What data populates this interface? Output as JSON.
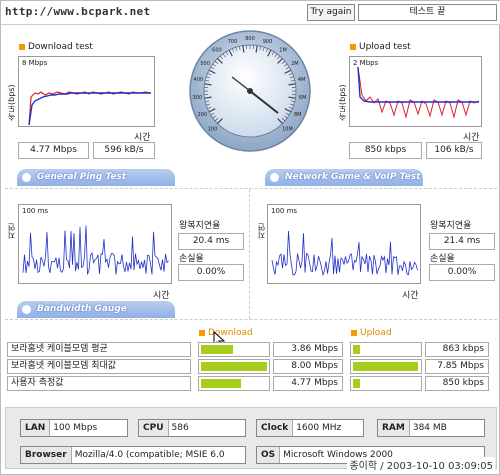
{
  "url": "http://www.bcpark.net",
  "buttons": {
    "try_again": "Try again",
    "end_test": "테스트 끝"
  },
  "download": {
    "title": "Download test",
    "scale": "8 Mbps",
    "ylabel": "속도(bps)",
    "xlabel": "시간",
    "kbps": "4.77 Mbps",
    "kBs": "596 kB/s"
  },
  "upload": {
    "title": "Upload test",
    "scale": "2 Mbps",
    "ylabel": "속도(bps)",
    "xlabel": "시간",
    "kbps": "850 kbps",
    "kBs": "106 kB/s"
  },
  "gauge_labels": [
    "100",
    "200",
    "300",
    "400",
    "500",
    "600",
    "700",
    "800",
    "900",
    "1M",
    "2M",
    "4M",
    "6M",
    "8M",
    "10M"
  ],
  "banners": {
    "ping": "General Ping Test",
    "game": "Network Game & VoIP Test",
    "bandwidth": "Bandwidth Gauge"
  },
  "ping_left": {
    "scale": "100 ms",
    "ylabel": "지연(ms)",
    "xlabel": "시간",
    "rtt_label": "왕복지연율",
    "rtt": "20.4 ms",
    "loss_label": "손실율",
    "loss": "0.00%"
  },
  "ping_right": {
    "scale": "100 ms",
    "ylabel": "지연(ms)",
    "xlabel": "시간",
    "rtt_label": "왕복지연율",
    "rtt": "21.4 ms",
    "loss_label": "손실율",
    "loss": "0.00%"
  },
  "gauge_headers": {
    "download": "Download",
    "upload": "Upload"
  },
  "rows": [
    {
      "label": "보라홈넷 케이블모뎀 평균",
      "down": "3.86 Mbps",
      "down_pct": 0.48,
      "up": "863 kbps",
      "up_pct": 0.11
    },
    {
      "label": "보라홈넷 케이블모뎀 최대값",
      "down": "8.00 Mbps",
      "down_pct": 1.0,
      "up": "7.85 Mbps",
      "up_pct": 0.98
    },
    {
      "label": "사용자 측정값",
      "down": "4.77 Mbps",
      "down_pct": 0.6,
      "up": "850 kbps",
      "up_pct": 0.11
    }
  ],
  "info": {
    "lan_k": "LAN",
    "lan_v": "100 Mbps",
    "cpu_k": "CPU",
    "cpu_v": "586",
    "clock_k": "Clock",
    "clock_v": "1600 MHz",
    "ram_k": "RAM",
    "ram_v": "384 MB",
    "browser_k": "Browser",
    "browser_v": "Mozilla/4.0 (compatible; MSIE 6.0",
    "os_k": "OS",
    "os_v": "Microsoft Windows 2000"
  },
  "footer": "종이학 / 2003-10-10 03:09:05",
  "colors": {
    "accent": "#f59a00",
    "bar": "#a6cc1c",
    "banner": "#8fb0e6",
    "series_red": "#d8232a",
    "series_blue": "#2030c8"
  }
}
